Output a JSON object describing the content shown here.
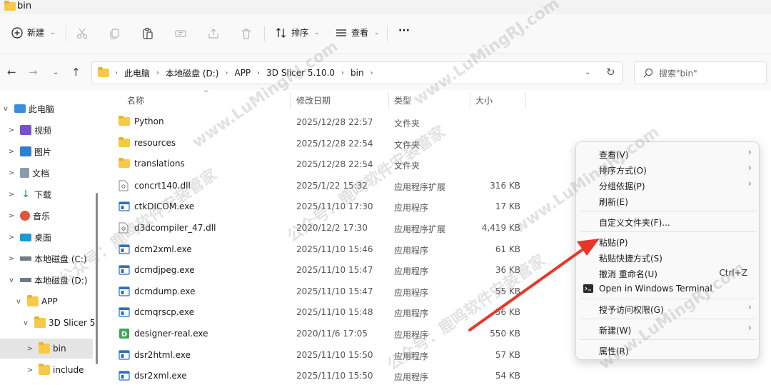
{
  "window": {
    "title": "bin"
  },
  "toolbar": {
    "new_label": "新建",
    "sort_label": "排序",
    "view_label": "查看",
    "more_label": "···"
  },
  "address": {
    "crumbs": [
      "此电脑",
      "本地磁盘 (D:)",
      "APP",
      "3D Slicer 5.10.0",
      "bin"
    ]
  },
  "search": {
    "placeholder": "搜索\"bin\""
  },
  "tree": {
    "items": [
      {
        "label": "此电脑",
        "expander": "v",
        "icon": "pc-icon"
      },
      {
        "label": "视频",
        "expander": ">",
        "icon": "video-icon"
      },
      {
        "label": "图片",
        "expander": ">",
        "icon": "pictures-icon"
      },
      {
        "label": "文档",
        "expander": ">",
        "icon": "documents-icon"
      },
      {
        "label": "下载",
        "expander": ">",
        "icon": "download-icon"
      },
      {
        "label": "音乐",
        "expander": ">",
        "icon": "music-icon"
      },
      {
        "label": "桌面",
        "expander": ">",
        "icon": "desktop-icon"
      },
      {
        "label": "本地磁盘 (C:)",
        "expander": ">",
        "icon": "drive-c-icon"
      },
      {
        "label": "本地磁盘 (D:)",
        "expander": "v",
        "icon": "drive-d-icon"
      },
      {
        "label": "APP",
        "expander": "v",
        "icon": "folder-icon"
      },
      {
        "label": "3D Slicer 5.",
        "expander": "v",
        "icon": "folder-icon"
      },
      {
        "label": "bin",
        "expander": ">",
        "icon": "folder-icon"
      },
      {
        "label": "include",
        "expander": ">",
        "icon": "folder-icon"
      }
    ]
  },
  "columns": {
    "name": "名称",
    "date": "修改日期",
    "type": "类型",
    "size": "大小"
  },
  "files": [
    {
      "name": "Python",
      "date": "2025/12/28 22:57",
      "type": "文件夹",
      "size": "",
      "kind": "folder"
    },
    {
      "name": "resources",
      "date": "2025/12/28 22:54",
      "type": "文件夹",
      "size": "",
      "kind": "folder"
    },
    {
      "name": "translations",
      "date": "2025/12/28 22:54",
      "type": "文件夹",
      "size": "",
      "kind": "folder"
    },
    {
      "name": "concrt140.dll",
      "date": "2025/1/22 15:32",
      "type": "应用程序扩展",
      "size": "316 KB",
      "kind": "dll"
    },
    {
      "name": "ctkDICOM.exe",
      "date": "2025/11/10 17:30",
      "type": "应用程序",
      "size": "17 KB",
      "kind": "exe"
    },
    {
      "name": "d3dcompiler_47.dll",
      "date": "2020/12/2 17:30",
      "type": "应用程序扩展",
      "size": "4,419 KB",
      "kind": "dll"
    },
    {
      "name": "dcm2xml.exe",
      "date": "2025/11/10 15:46",
      "type": "应用程序",
      "size": "61 KB",
      "kind": "exe"
    },
    {
      "name": "dcmdjpeg.exe",
      "date": "2025/11/10 15:47",
      "type": "应用程序",
      "size": "36 KB",
      "kind": "exe"
    },
    {
      "name": "dcmdump.exe",
      "date": "2025/11/10 15:47",
      "type": "应用程序",
      "size": "55 KB",
      "kind": "exe"
    },
    {
      "name": "dcmqrscp.exe",
      "date": "2025/11/10 15:48",
      "type": "应用程序",
      "size": "56 KB",
      "kind": "exe"
    },
    {
      "name": "designer-real.exe",
      "date": "2020/11/6 17:05",
      "type": "应用程序",
      "size": "550 KB",
      "kind": "green-exe"
    },
    {
      "name": "dsr2html.exe",
      "date": "2025/11/10 15:50",
      "type": "应用程序",
      "size": "57 KB",
      "kind": "exe"
    },
    {
      "name": "dsr2xml.exe",
      "date": "2025/11/10 15:50",
      "type": "应用程序",
      "size": "54 KB",
      "kind": "exe"
    }
  ],
  "context_menu": {
    "items": [
      {
        "label": "查看(V)",
        "shortcut": "",
        "submenu": true
      },
      {
        "label": "排序方式(O)",
        "shortcut": "",
        "submenu": true
      },
      {
        "label": "分组依据(P)",
        "shortcut": "",
        "submenu": true
      },
      {
        "label": "刷新(E)",
        "shortcut": "",
        "submenu": false
      },
      {
        "label": "自定义文件夹(F)...",
        "shortcut": "",
        "submenu": false
      },
      {
        "label": "粘贴(P)",
        "shortcut": "",
        "submenu": false
      },
      {
        "label": "粘贴快捷方式(S)",
        "shortcut": "",
        "submenu": false
      },
      {
        "label": "撤消 重命名(U)",
        "shortcut": "Ctrl+Z",
        "submenu": false
      },
      {
        "label": "Open in Windows Terminal",
        "shortcut": "",
        "submenu": false
      },
      {
        "label": "授予访问权限(G)",
        "shortcut": "",
        "submenu": true
      },
      {
        "label": "新建(W)",
        "shortcut": "",
        "submenu": true
      },
      {
        "label": "属性(R)",
        "shortcut": "",
        "submenu": false
      }
    ]
  },
  "watermark": {
    "text1": "www.LuMingRJ.com",
    "text2": "公众号：鹿鸣软件安装管家"
  },
  "colors": {
    "accent": "#0067c0",
    "arrow": "#e8362b",
    "folder": "#f7c948"
  }
}
